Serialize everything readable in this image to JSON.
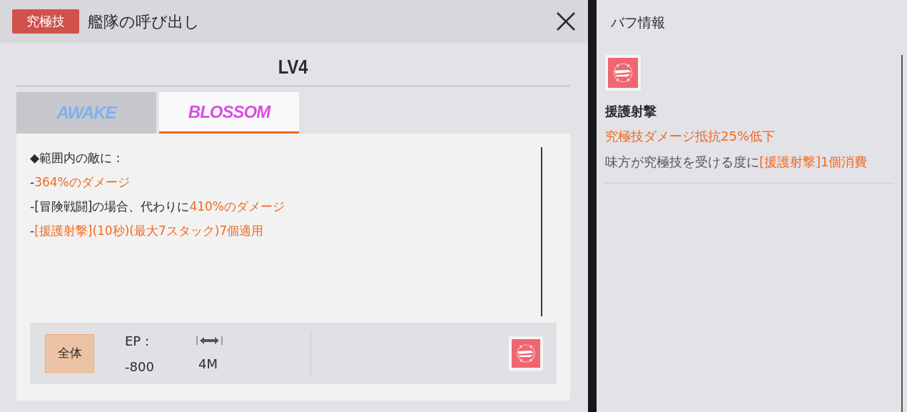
{
  "skill": {
    "type_badge": "究極技",
    "name": "艦隊の呼び出し",
    "level": "LV4"
  },
  "tabs": [
    {
      "label": "AWAKE",
      "selected": false
    },
    {
      "label": "BLOSSOM",
      "selected": true
    }
  ],
  "description": [
    [
      {
        "text": "◆範囲内の敵に：",
        "highlight": false
      }
    ],
    [
      {
        "text": "-",
        "highlight": false
      },
      {
        "text": "364%のダメージ",
        "highlight": true
      }
    ],
    [
      {
        "text": "-[冒険戦闘]の場合、代わりに",
        "highlight": false
      },
      {
        "text": "410%のダメージ",
        "highlight": true
      }
    ],
    [
      {
        "text": "-",
        "highlight": false
      },
      {
        "text": "[援護射撃](10秒)(最大7スタック)7個適用",
        "highlight": true
      }
    ]
  ],
  "footer": {
    "target": "全体",
    "ep_label": "EP：",
    "ep_value": "-800",
    "range_value": "4M"
  },
  "buff_panel": {
    "title": "バフ情報",
    "buffs": [
      {
        "name": "援護射撃",
        "effect": "究極技ダメージ抵抗25%低下",
        "note": [
          {
            "text": "味方が究極技を受ける度に",
            "highlight": false
          },
          {
            "text": "[援護射撃]1個消費",
            "highlight": true
          }
        ]
      }
    ]
  }
}
